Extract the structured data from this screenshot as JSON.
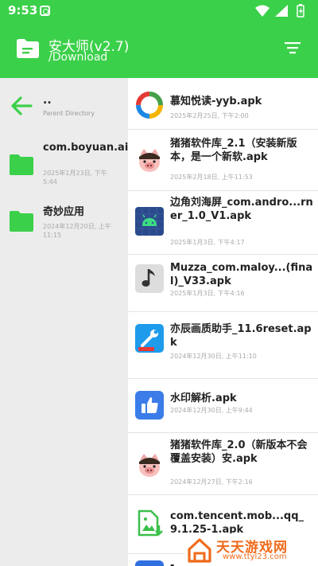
{
  "status_bar": {
    "time": "9:53"
  },
  "header": {
    "title": "安大师(v2.7)",
    "path": "/Download"
  },
  "parent": {
    "dots": "..",
    "label": "Parent Directory"
  },
  "folders": [
    {
      "name": "com.boyuan.ai.book",
      "date": "2025年1月23日, 下午5:44"
    },
    {
      "name": "奇妙应用",
      "date": "2024年12月20日, 上午11:15"
    }
  ],
  "files": [
    {
      "name": "慕知悦读-yyb.apk",
      "date": "2025年2月25日, 下午2:00",
      "icon": "colorful-circle-icon"
    },
    {
      "name": "猪猪软件库_2.1（安装新版本，是一个新软.apk",
      "date": "2025年2月18日, 上午11:53",
      "icon": "pig-icon"
    },
    {
      "name": "边角刘海屏_com.andro...rner_1.0_V1.apk",
      "date": "2025年1月3日, 下午4:17",
      "icon": "android-icon"
    },
    {
      "name": "Muzza_com.maloy...(final)_V33.apk",
      "date": "2025年1月3日, 下午4:16",
      "icon": "music-note-icon"
    },
    {
      "name": "亦辰画质助手_11.6reset.apk",
      "date": "2024年12月30日, 上午11:10",
      "icon": "wrench-icon"
    },
    {
      "name": "水印解析.apk",
      "date": "2024年12月30日, 上午9:44",
      "icon": "thumbs-up-icon"
    },
    {
      "name": "猪猪软件库_2.0（新版本不会覆盖安装）安.apk",
      "date": "2024年12月27日, 下午2:16",
      "icon": "pig-icon"
    },
    {
      "name": "com.tencent.mob...qq_9.1.25-1.apk",
      "date": "",
      "icon": "image-download-icon"
    },
    {
      "name": "-",
      "date": "",
      "icon": "pen-icon"
    }
  ],
  "watermark": {
    "text": "天天游戏网",
    "url": "www.ttyl23.com"
  },
  "colors": {
    "accent": "#3bd04a",
    "left_panel_bg": "#ececec",
    "watermark": "#f06a1a"
  }
}
